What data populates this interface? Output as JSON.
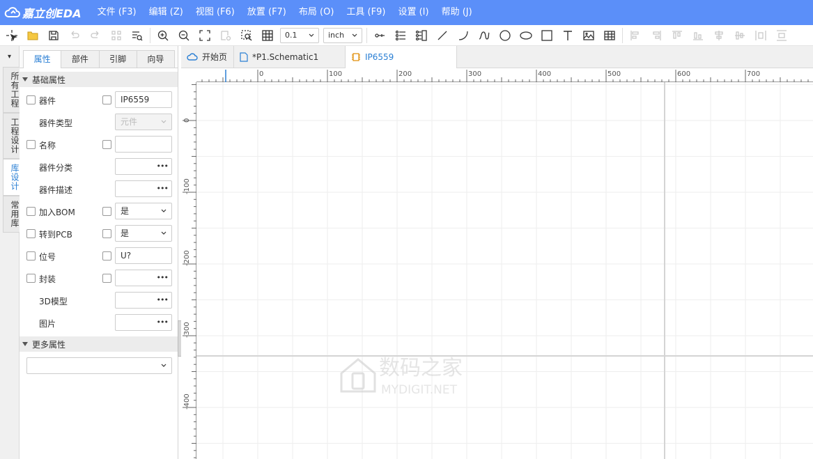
{
  "app": {
    "logo_text": "嘉立创EDA"
  },
  "menu": [
    "文件 (F3)",
    "编辑 (Z)",
    "视图 (F6)",
    "放置 (F7)",
    "布局 (O)",
    "工具 (F9)",
    "设置 (I)",
    "帮助 (J)"
  ],
  "toolbar": {
    "grid_value": "0.1",
    "unit_value": "inch"
  },
  "left_tabs": {
    "pin": "▾",
    "items": [
      "所有工程",
      "工程设计",
      "库设计",
      "常用库"
    ],
    "active_index": 2
  },
  "panel": {
    "tabs": [
      "属性",
      "部件",
      "引脚",
      "向导"
    ],
    "basic_section": "基础属性",
    "more_section": "更多属性",
    "props": [
      {
        "label": "器件",
        "value": "IP6559"
      },
      {
        "label": "器件类型",
        "value": "元件"
      },
      {
        "label": "名称",
        "value": ""
      },
      {
        "label": "器件分类",
        "value": ""
      },
      {
        "label": "器件描述",
        "value": ""
      },
      {
        "label": "加入BOM",
        "value": "是"
      },
      {
        "label": "转到PCB",
        "value": "是"
      },
      {
        "label": "位号",
        "value": "U?"
      },
      {
        "label": "封装",
        "value": ""
      },
      {
        "label": "3D模型",
        "value": ""
      },
      {
        "label": "图片",
        "value": ""
      }
    ],
    "more_select_value": ""
  },
  "doc_tabs": [
    "开始页",
    "*P1.Schematic1",
    "IP6559"
  ],
  "ruler": {
    "top_labels": [
      "0",
      "100",
      "200",
      "300",
      "400",
      "500",
      "600",
      "700"
    ],
    "left_labels": [
      "0",
      "-100",
      "-200",
      "-300",
      "-400"
    ]
  },
  "watermark": {
    "cn": "数码之家",
    "en": "MYDIGIT.NET"
  },
  "colors": {
    "menubar": "#5b8ff9",
    "accent": "#2a7fd4",
    "grid": "#eeeeee",
    "axis": "#d4d4d4"
  }
}
